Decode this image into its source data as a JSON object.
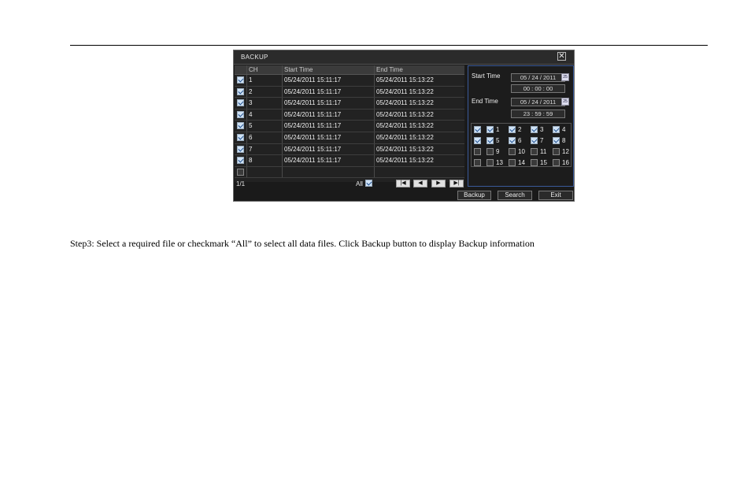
{
  "dialog": {
    "title": "BACKUP",
    "close_glyph": "✕",
    "columns": {
      "ch": "CH",
      "start": "Start Time",
      "end": "End Time"
    },
    "rows": [
      {
        "ch": "1",
        "start": "05/24/2011 15:11:17",
        "end": "05/24/2011 15:13:22",
        "checked": true
      },
      {
        "ch": "2",
        "start": "05/24/2011 15:11:17",
        "end": "05/24/2011 15:13:22",
        "checked": true
      },
      {
        "ch": "3",
        "start": "05/24/2011 15:11:17",
        "end": "05/24/2011 15:13:22",
        "checked": true
      },
      {
        "ch": "4",
        "start": "05/24/2011 15:11:17",
        "end": "05/24/2011 15:13:22",
        "checked": true
      },
      {
        "ch": "5",
        "start": "05/24/2011 15:11:17",
        "end": "05/24/2011 15:13:22",
        "checked": true
      },
      {
        "ch": "6",
        "start": "05/24/2011 15:11:17",
        "end": "05/24/2011 15:13:22",
        "checked": true
      },
      {
        "ch": "7",
        "start": "05/24/2011 15:11:17",
        "end": "05/24/2011 15:13:22",
        "checked": true
      },
      {
        "ch": "8",
        "start": "05/24/2011 15:11:17",
        "end": "05/24/2011 15:13:22",
        "checked": true
      },
      {
        "ch": "",
        "start": "",
        "end": "",
        "checked": false
      }
    ],
    "page_indicator": "1/1",
    "all_label": "All",
    "all_checked": true,
    "nav": {
      "first": "|◀",
      "prev": "◀",
      "next": "▶",
      "last": "▶|"
    },
    "search_panel": {
      "start_label": "Start Time",
      "start_date": "05 / 24 / 2011",
      "start_time": "00 : 00 : 00",
      "end_label": "End Time",
      "end_date": "05 / 24 / 2011",
      "end_time": "23 : 59 : 59",
      "calendar_glyph": "25"
    },
    "channel_rows": [
      {
        "row_checked": true,
        "channels": [
          {
            "label": "1",
            "checked": true
          },
          {
            "label": "2",
            "checked": true
          },
          {
            "label": "3",
            "checked": true
          },
          {
            "label": "4",
            "checked": true
          }
        ]
      },
      {
        "row_checked": true,
        "channels": [
          {
            "label": "5",
            "checked": true
          },
          {
            "label": "6",
            "checked": true
          },
          {
            "label": "7",
            "checked": true
          },
          {
            "label": "8",
            "checked": true
          }
        ]
      },
      {
        "row_checked": false,
        "channels": [
          {
            "label": "9",
            "checked": false
          },
          {
            "label": "10",
            "checked": false
          },
          {
            "label": "11",
            "checked": false
          },
          {
            "label": "12",
            "checked": false
          }
        ]
      },
      {
        "row_checked": false,
        "channels": [
          {
            "label": "13",
            "checked": false
          },
          {
            "label": "14",
            "checked": false
          },
          {
            "label": "15",
            "checked": false
          },
          {
            "label": "16",
            "checked": false
          }
        ]
      }
    ],
    "buttons": {
      "backup": "Backup",
      "search": "Search",
      "exit": "Exit"
    }
  },
  "caption": "Step3: Select a required file or checkmark “All” to select all data files. Click Backup button to display Backup information"
}
